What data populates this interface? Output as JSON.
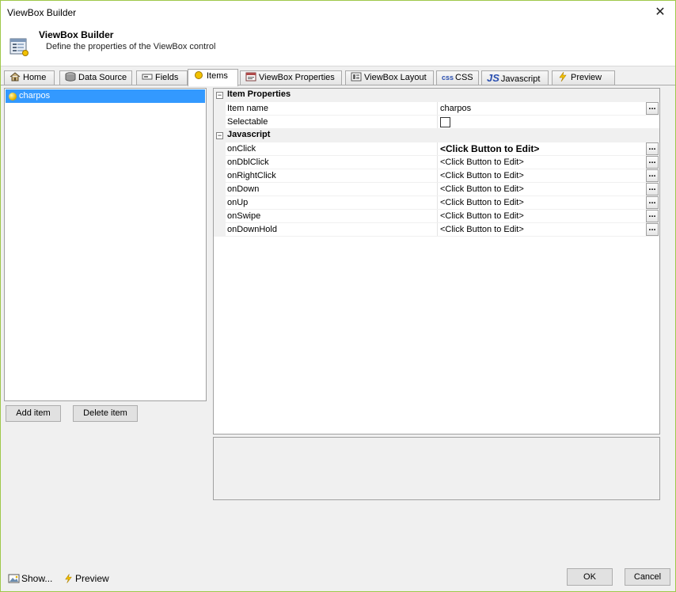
{
  "window": {
    "title": "ViewBox Builder",
    "close_glyph": "✕"
  },
  "header": {
    "title": "ViewBox Builder",
    "description": "Define the properties of the ViewBox control",
    "icon": "form-icon"
  },
  "tabs": [
    {
      "label": "Home",
      "icon": "home-icon"
    },
    {
      "label": "Data Source",
      "icon": "database-icon"
    },
    {
      "label": "Fields",
      "icon": "fields-icon"
    },
    {
      "label": "Items",
      "icon": "item-dot-icon",
      "active": true
    },
    {
      "label": "ViewBox Properties",
      "icon": "properties-icon"
    },
    {
      "label": "ViewBox Layout",
      "icon": "layout-icon"
    },
    {
      "label": "CSS",
      "icon": "css-icon"
    },
    {
      "label": "Javascript",
      "icon": "js-icon"
    },
    {
      "label": "Preview",
      "icon": "lightning-icon"
    }
  ],
  "items_list": {
    "items": [
      {
        "label": "charpos",
        "selected": true
      }
    ]
  },
  "buttons": {
    "add_item": "Add item",
    "delete_item": "Delete item",
    "ok": "OK",
    "cancel": "Cancel"
  },
  "property_grid": {
    "item_properties": {
      "category": "Item Properties",
      "item_name_label": "Item name",
      "item_name_value": "charpos",
      "selectable_label": "Selectable",
      "selectable_checked": false
    },
    "javascript": {
      "category": "Javascript",
      "rows": [
        {
          "name": "onClick",
          "value": "<Click Button to Edit>"
        },
        {
          "name": "onDblClick",
          "value": "<Click Button to Edit>"
        },
        {
          "name": "onRightClick",
          "value": "<Click Button to Edit>"
        },
        {
          "name": "onDown",
          "value": "<Click Button to Edit>"
        },
        {
          "name": "onUp",
          "value": "<Click Button to Edit>"
        },
        {
          "name": "onSwipe",
          "value": "<Click Button to Edit>"
        },
        {
          "name": "onDownHold",
          "value": "<Click Button to Edit>"
        }
      ]
    },
    "collapse_glyph": "−",
    "ellipsis": "..."
  },
  "footer": {
    "show_label": "Show...",
    "preview_label": "Preview"
  },
  "colors": {
    "selection": "#3399ff",
    "window_border": "#9fc84a"
  }
}
